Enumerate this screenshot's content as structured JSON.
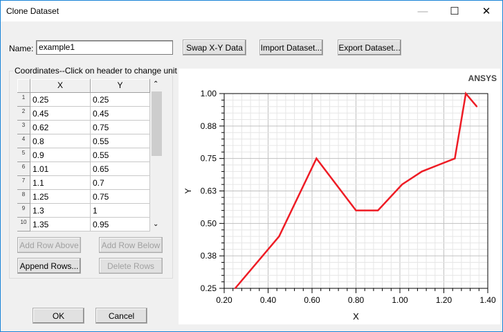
{
  "window": {
    "title": "Clone Dataset",
    "minimize": "—",
    "maximize": "☐",
    "close": "✕"
  },
  "name": {
    "label": "Name:",
    "value": "example1"
  },
  "toolbar": {
    "swap": "Swap X-Y Data",
    "import": "Import Dataset...",
    "export": "Export Dataset..."
  },
  "coords": {
    "group_label": "Coordinates--Click on header to change unit",
    "headers": [
      "X",
      "Y"
    ],
    "rows": [
      [
        "1",
        "0.25",
        "0.25"
      ],
      [
        "2",
        "0.45",
        "0.45"
      ],
      [
        "3",
        "0.62",
        "0.75"
      ],
      [
        "4",
        "0.8",
        "0.55"
      ],
      [
        "5",
        "0.9",
        "0.55"
      ],
      [
        "6",
        "1.01",
        "0.65"
      ],
      [
        "7",
        "1.1",
        "0.7"
      ],
      [
        "8",
        "1.25",
        "0.75"
      ],
      [
        "9",
        "1.3",
        "1"
      ],
      [
        "10",
        "1.35",
        "0.95"
      ]
    ],
    "add_above": "Add Row Above",
    "add_below": "Add Row Below",
    "append": "Append Rows...",
    "delete": "Delete Rows"
  },
  "dialog": {
    "ok": "OK",
    "cancel": "Cancel"
  },
  "chart_data": {
    "type": "line",
    "brand": "ANSYS",
    "xlabel": "X",
    "ylabel": "Y",
    "xlim": [
      0.2,
      1.4
    ],
    "ylim": [
      0.25,
      1.0
    ],
    "xticks": [
      "0.20",
      "0.40",
      "0.60",
      "0.80",
      "1.00",
      "1.20",
      "1.40"
    ],
    "yticks": [
      "0.25",
      "0.38",
      "0.50",
      "0.63",
      "0.75",
      "0.88",
      "1.00"
    ],
    "grid": true,
    "color": "#ee1c25",
    "x": [
      0.25,
      0.45,
      0.62,
      0.8,
      0.9,
      1.01,
      1.1,
      1.25,
      1.3,
      1.35
    ],
    "y": [
      0.25,
      0.45,
      0.75,
      0.55,
      0.55,
      0.65,
      0.7,
      0.75,
      1.0,
      0.95
    ]
  }
}
